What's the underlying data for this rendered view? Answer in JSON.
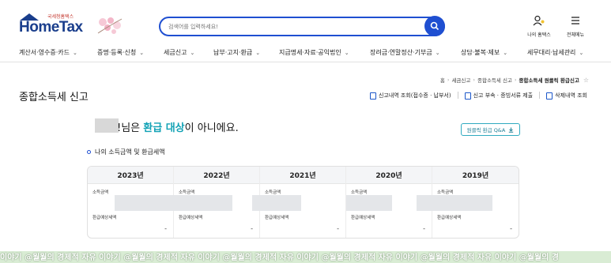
{
  "header": {
    "logo_text": "HomeTax",
    "logo_subtext": "국세청홈택스",
    "search_placeholder": "검색어를 입력하세요!",
    "my_hometax_label": "나의 홈택스",
    "full_menu_label": "전체메뉴"
  },
  "nav": {
    "items": [
      {
        "label": "계산서·영수증·카드"
      },
      {
        "label": "증명·등록·신청"
      },
      {
        "label": "세금신고"
      },
      {
        "label": "납부·고지·환급"
      },
      {
        "label": "지급명세·자료·공익법인"
      },
      {
        "label": "장려금·연말정산·기부금"
      },
      {
        "label": "상담·불복·제보"
      },
      {
        "label": "세무대리·납세관리"
      }
    ]
  },
  "breadcrumb": {
    "items": [
      "홈",
      "세금신고",
      "종합소득세 신고"
    ],
    "current": "종합소득세 원클릭 환급신고"
  },
  "page": {
    "title": "종합소득세 신고",
    "actions": [
      {
        "label": "신고내역 조회(접수증 · 납부서)"
      },
      {
        "label": "신고 부속 · 증빙서류 제출"
      },
      {
        "label": "삭제내역 조회"
      }
    ]
  },
  "result": {
    "prefix": "!님은 ",
    "highlight": "환급 대상",
    "suffix": "이 아니에요.",
    "qa_button": "원클릭 환급 Q&A"
  },
  "section": {
    "title": "나의 소득금액 및 환급세액"
  },
  "years": {
    "income_label": "소득금액",
    "refund_label": "환급예상세액",
    "columns": [
      {
        "year": "2023년",
        "refund": "-"
      },
      {
        "year": "2022년",
        "refund": "-"
      },
      {
        "year": "2021년",
        "refund": "-"
      },
      {
        "year": "2020년",
        "refund": "-"
      },
      {
        "year": "2019년",
        "refund": "-"
      }
    ]
  },
  "watermark": "이야기 @월월의 경제적 자유 이야기 @월월의 경제적 자유 이야기 @월월의 경제적 자유 이야기 @월월의 경제적 자유 이야기 @월월의 경제적 자유 이야기 @월월의 경",
  "colors": {
    "brand_blue": "#1f4fd1",
    "highlight_teal": "#11a2b5",
    "logo_navy": "#1a3e8c"
  }
}
